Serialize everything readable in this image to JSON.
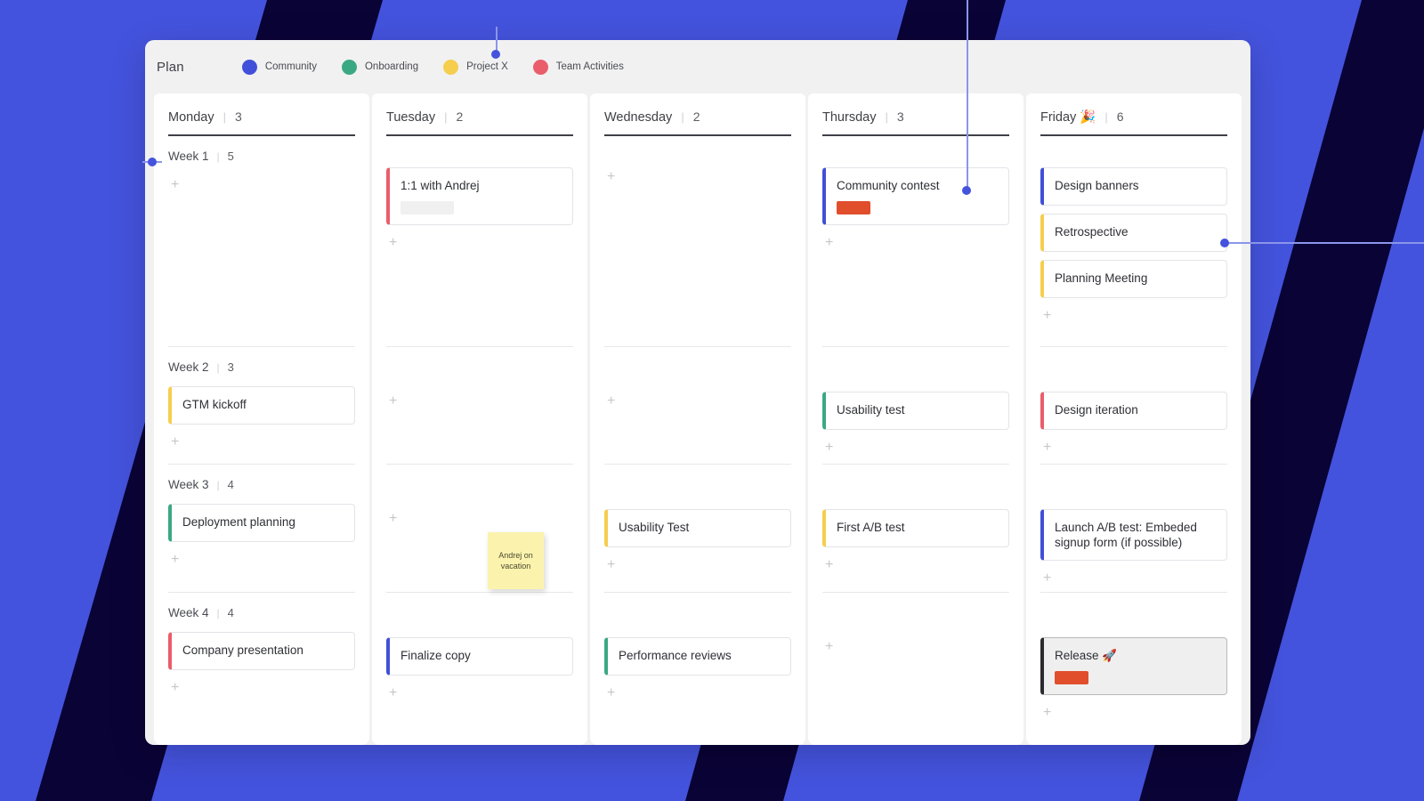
{
  "theme": {
    "bg_blue": "#4453dd",
    "bg_navy": "#0a0336",
    "panel_bg": "#f1f1f2",
    "connector": "#8b95ea"
  },
  "header": {
    "title": "Plan",
    "legend": [
      {
        "label": "Community",
        "color": "#4150d8",
        "icon": "legend-dot-icon"
      },
      {
        "label": "Onboarding",
        "color": "#3ba884",
        "icon": "legend-dot-icon"
      },
      {
        "label": "Project X",
        "color": "#f6ce4e",
        "icon": "legend-dot-icon"
      },
      {
        "label": "Team Activities",
        "color": "#ea5d6a",
        "icon": "legend-dot-icon"
      }
    ]
  },
  "add_label": "+",
  "separator": "|",
  "sticky_note": {
    "text": "Andrej on vacation"
  },
  "weeks": [
    {
      "name": "Week 1",
      "count": "5"
    },
    {
      "name": "Week 2",
      "count": "3"
    },
    {
      "name": "Week 3",
      "count": "4"
    },
    {
      "name": "Week 4",
      "count": "4"
    }
  ],
  "columns": [
    {
      "day": "Monday",
      "count": "3",
      "weeks": [
        {
          "cards": []
        },
        {
          "cards": [
            {
              "title": "GTM kickoff",
              "color": "#f6ce4e"
            }
          ]
        },
        {
          "cards": [
            {
              "title": "Deployment planning",
              "color": "#3ba884"
            }
          ]
        },
        {
          "cards": [
            {
              "title": "Company presentation",
              "color": "#ea5d6a"
            }
          ]
        }
      ]
    },
    {
      "day": "Tuesday",
      "count": "2",
      "weeks": [
        {
          "cards": [
            {
              "title": "1:1 with Andrej",
              "color": "#ea5d6a",
              "placeholder": true
            }
          ]
        },
        {
          "cards": []
        },
        {
          "cards": []
        },
        {
          "cards": [
            {
              "title": "Finalize copy",
              "color": "#4150d8"
            }
          ]
        }
      ]
    },
    {
      "day": "Wednesday",
      "count": "2",
      "weeks": [
        {
          "cards": []
        },
        {
          "cards": []
        },
        {
          "cards": [
            {
              "title": "Usability Test",
              "color": "#f6ce4e"
            }
          ]
        },
        {
          "cards": [
            {
              "title": "Performance reviews",
              "color": "#3ba884"
            }
          ]
        }
      ]
    },
    {
      "day": "Thursday",
      "count": "3",
      "weeks": [
        {
          "cards": [
            {
              "title": "Community contest",
              "color": "#4150d8",
              "chip": "#e04e2c"
            }
          ]
        },
        {
          "cards": [
            {
              "title": "Usability test",
              "color": "#3ba884"
            }
          ]
        },
        {
          "cards": [
            {
              "title": "First A/B test",
              "color": "#f6ce4e"
            }
          ]
        },
        {
          "cards": []
        }
      ]
    },
    {
      "day": "Friday 🎉",
      "count": "6",
      "weeks": [
        {
          "cards": [
            {
              "title": "Design banners",
              "color": "#4150d8"
            },
            {
              "title": "Retrospective",
              "color": "#f6ce4e"
            },
            {
              "title": "Planning Meeting",
              "color": "#f6ce4e"
            }
          ]
        },
        {
          "cards": [
            {
              "title": "Design iteration",
              "color": "#ea5d6a"
            }
          ]
        },
        {
          "cards": [
            {
              "title": "Launch A/B test: Embeded signup form (if possible)",
              "color": "#4150d8"
            }
          ]
        },
        {
          "cards": [
            {
              "title": "Release 🚀",
              "color": "#2b2b2f",
              "chip": "#e04e2c",
              "selected": true
            }
          ]
        }
      ]
    }
  ]
}
